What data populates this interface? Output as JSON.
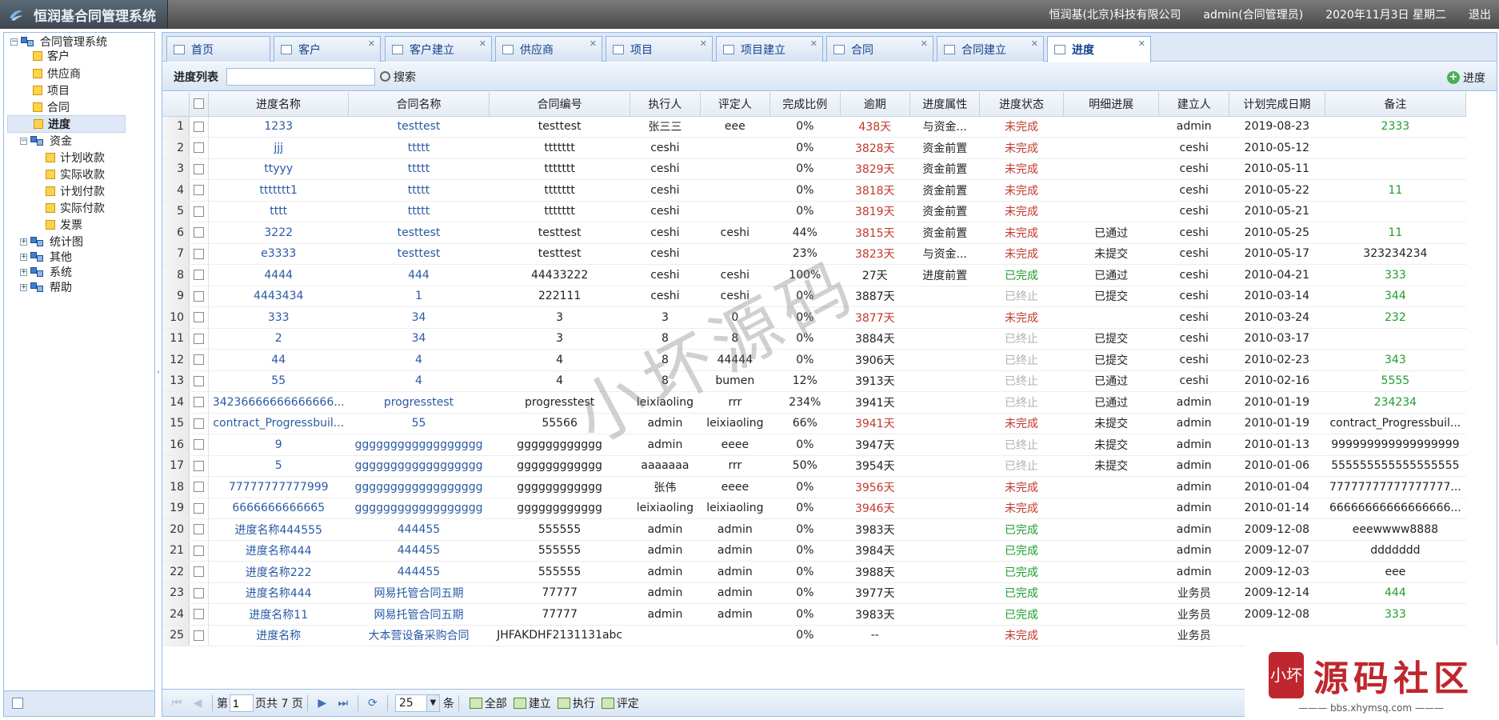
{
  "app": {
    "title": "恒润基合同管理系统",
    "company": "恒润基(北京)科技有限公司",
    "user": "admin(合同管理员)",
    "date": "2020年11月3日 星期二",
    "logout": "退出"
  },
  "sidebar": {
    "root": "合同管理系统",
    "items": [
      {
        "label": "客户",
        "icon": "leaf-icon"
      },
      {
        "label": "供应商",
        "icon": "leaf-icon"
      },
      {
        "label": "项目",
        "icon": "leaf-icon"
      },
      {
        "label": "合同",
        "icon": "leaf-icon"
      },
      {
        "label": "进度",
        "icon": "leaf-icon",
        "selected": true
      },
      {
        "label": "资金",
        "icon": "module-icon",
        "expanded": true
      },
      {
        "label": "计划收款",
        "icon": "leaf-icon"
      },
      {
        "label": "实际收款",
        "icon": "leaf-icon"
      },
      {
        "label": "计划付款",
        "icon": "leaf-icon"
      },
      {
        "label": "实际付款",
        "icon": "leaf-icon"
      },
      {
        "label": "发票",
        "icon": "leaf-icon"
      },
      {
        "label": "统计图",
        "icon": "module-icon"
      },
      {
        "label": "其他",
        "icon": "module-icon"
      },
      {
        "label": "系统",
        "icon": "module-icon"
      },
      {
        "label": "帮助",
        "icon": "module-icon"
      }
    ]
  },
  "tabs": [
    {
      "label": "首页",
      "closable": false
    },
    {
      "label": "客户",
      "closable": true
    },
    {
      "label": "客户建立",
      "closable": true
    },
    {
      "label": "供应商",
      "closable": true
    },
    {
      "label": "项目",
      "closable": true
    },
    {
      "label": "项目建立",
      "closable": true
    },
    {
      "label": "合同",
      "closable": true
    },
    {
      "label": "合同建立",
      "closable": true
    },
    {
      "label": "进度",
      "closable": true,
      "active": true
    }
  ],
  "toolbar": {
    "title": "进度列表",
    "search_label": "搜索",
    "search_value": "",
    "add_label": "进度"
  },
  "grid": {
    "columns": [
      "进度名称",
      "合同名称",
      "合同编号",
      "执行人",
      "评定人",
      "完成比例",
      "逾期",
      "进度属性",
      "进度状态",
      "明细进展",
      "建立人",
      "计划完成日期",
      "备注"
    ],
    "rows": [
      [
        "1233",
        "testtest",
        "testtest",
        "张三三",
        "eee",
        "0%",
        "438天",
        "与资金...",
        "未完成",
        "",
        "admin",
        "2019-08-23",
        "2333"
      ],
      [
        "jjj",
        "ttttt",
        "ttttttt",
        "ceshi",
        "",
        "0%",
        "3828天",
        "资金前置",
        "未完成",
        "",
        "ceshi",
        "2010-05-12",
        ""
      ],
      [
        "ttyyy",
        "ttttt",
        "ttttttt",
        "ceshi",
        "",
        "0%",
        "3829天",
        "资金前置",
        "未完成",
        "",
        "ceshi",
        "2010-05-11",
        ""
      ],
      [
        "ttttttt1",
        "ttttt",
        "ttttttt",
        "ceshi",
        "",
        "0%",
        "3818天",
        "资金前置",
        "未完成",
        "",
        "ceshi",
        "2010-05-22",
        "11"
      ],
      [
        "tttt",
        "ttttt",
        "ttttttt",
        "ceshi",
        "",
        "0%",
        "3819天",
        "资金前置",
        "未完成",
        "",
        "ceshi",
        "2010-05-21",
        ""
      ],
      [
        "3222",
        "testtest",
        "testtest",
        "ceshi",
        "ceshi",
        "44%",
        "3815天",
        "资金前置",
        "未完成",
        "已通过",
        "ceshi",
        "2010-05-25",
        "11"
      ],
      [
        "e3333",
        "testtest",
        "testtest",
        "ceshi",
        "",
        "23%",
        "3823天",
        "与资金...",
        "未完成",
        "未提交",
        "ceshi",
        "2010-05-17",
        "323234234"
      ],
      [
        "4444",
        "444",
        "44433222",
        "ceshi",
        "ceshi",
        "100%",
        "27天",
        "进度前置",
        "已完成",
        "已通过",
        "ceshi",
        "2010-04-21",
        "333"
      ],
      [
        "4443434",
        "1",
        "222111",
        "ceshi",
        "ceshi",
        "0%",
        "3887天",
        "",
        "已终止",
        "已提交",
        "ceshi",
        "2010-03-14",
        "344"
      ],
      [
        "333",
        "34",
        "3",
        "3",
        "0",
        "0%",
        "3877天",
        "",
        "未完成",
        "",
        "ceshi",
        "2010-03-24",
        "232"
      ],
      [
        "2",
        "34",
        "3",
        "8",
        "8",
        "0%",
        "3884天",
        "",
        "已终止",
        "已提交",
        "ceshi",
        "2010-03-17",
        ""
      ],
      [
        "44",
        "4",
        "4",
        "8",
        "44444",
        "0%",
        "3906天",
        "",
        "已终止",
        "已提交",
        "ceshi",
        "2010-02-23",
        "343"
      ],
      [
        "55",
        "4",
        "4",
        "8",
        "bumen",
        "12%",
        "3913天",
        "",
        "已终止",
        "已通过",
        "ceshi",
        "2010-02-16",
        "5555"
      ],
      [
        "34236666666666666...",
        "progresstest",
        "progresstest",
        "leixiaoling",
        "rrr",
        "234%",
        "3941天",
        "",
        "已终止",
        "已通过",
        "admin",
        "2010-01-19",
        "234234"
      ],
      [
        "contract_Progressbuil...",
        "55",
        "55566",
        "admin",
        "leixiaoling",
        "66%",
        "3941天",
        "",
        "未完成",
        "未提交",
        "admin",
        "2010-01-19",
        "contract_Progressbuil..."
      ],
      [
        "9",
        "gggggggggggggggggg",
        "gggggggggggg",
        "admin",
        "eeee",
        "0%",
        "3947天",
        "",
        "已终止",
        "未提交",
        "admin",
        "2010-01-13",
        "999999999999999999"
      ],
      [
        "5",
        "gggggggggggggggggg",
        "gggggggggggg",
        "aaaaaaa",
        "rrr",
        "50%",
        "3954天",
        "",
        "已终止",
        "未提交",
        "admin",
        "2010-01-06",
        "555555555555555555"
      ],
      [
        "77777777777999",
        "gggggggggggggggggg",
        "gggggggggggg",
        "张伟",
        "eeee",
        "0%",
        "3956天",
        "",
        "未完成",
        "",
        "admin",
        "2010-01-04",
        "77777777777777777..."
      ],
      [
        "6666666666665",
        "gggggggggggggggggg",
        "gggggggggggg",
        "leixiaoling",
        "leixiaoling",
        "0%",
        "3946天",
        "",
        "未完成",
        "",
        "admin",
        "2010-01-14",
        "66666666666666666..."
      ],
      [
        "进度名称444555",
        "444455",
        "555555",
        "admin",
        "admin",
        "0%",
        "3983天",
        "",
        "已完成",
        "",
        "admin",
        "2009-12-08",
        "eeewwww8888"
      ],
      [
        "进度名称444",
        "444455",
        "555555",
        "admin",
        "admin",
        "0%",
        "3984天",
        "",
        "已完成",
        "",
        "admin",
        "2009-12-07",
        "ddddddd"
      ],
      [
        "进度名称222",
        "444455",
        "555555",
        "admin",
        "admin",
        "0%",
        "3988天",
        "",
        "已完成",
        "",
        "admin",
        "2009-12-03",
        "eee"
      ],
      [
        "进度名称444",
        "网易托管合同五期",
        "77777",
        "admin",
        "admin",
        "0%",
        "3977天",
        "",
        "已完成",
        "",
        "业务员",
        "2009-12-14",
        "444"
      ],
      [
        "进度名称11",
        "网易托管合同五期",
        "77777",
        "admin",
        "admin",
        "0%",
        "3983天",
        "",
        "已完成",
        "",
        "业务员",
        "2009-12-08",
        "333"
      ],
      [
        "进度名称",
        "大本营设备采购合同",
        "JHFAKDHF2131131abc",
        "",
        "",
        "0%",
        "--",
        "",
        "未完成",
        "",
        "业务员",
        "",
        ""
      ]
    ],
    "overdue_red": [
      true,
      true,
      true,
      true,
      true,
      true,
      true,
      false,
      false,
      true,
      false,
      false,
      false,
      false,
      true,
      false,
      false,
      true,
      true,
      false,
      false,
      false,
      false,
      false,
      false
    ]
  },
  "pager": {
    "page_prefix": "第",
    "page": "1",
    "page_suffix": "页共 7 页",
    "page_size": "25",
    "size_suffix": "条",
    "actions": [
      "全部",
      "建立",
      "执行",
      "评定"
    ]
  },
  "watermark": "小坏源码",
  "brand": {
    "seal": "小坏",
    "name": "源码社区",
    "url": "——— bbs.xhymsq.com ———"
  },
  "colors": {
    "link": "#2a5aa5",
    "not_done": "#c0392b",
    "done": "#1e9e2e",
    "terminated": "#b0b0b0",
    "header_bar": "#4a4a4a"
  }
}
